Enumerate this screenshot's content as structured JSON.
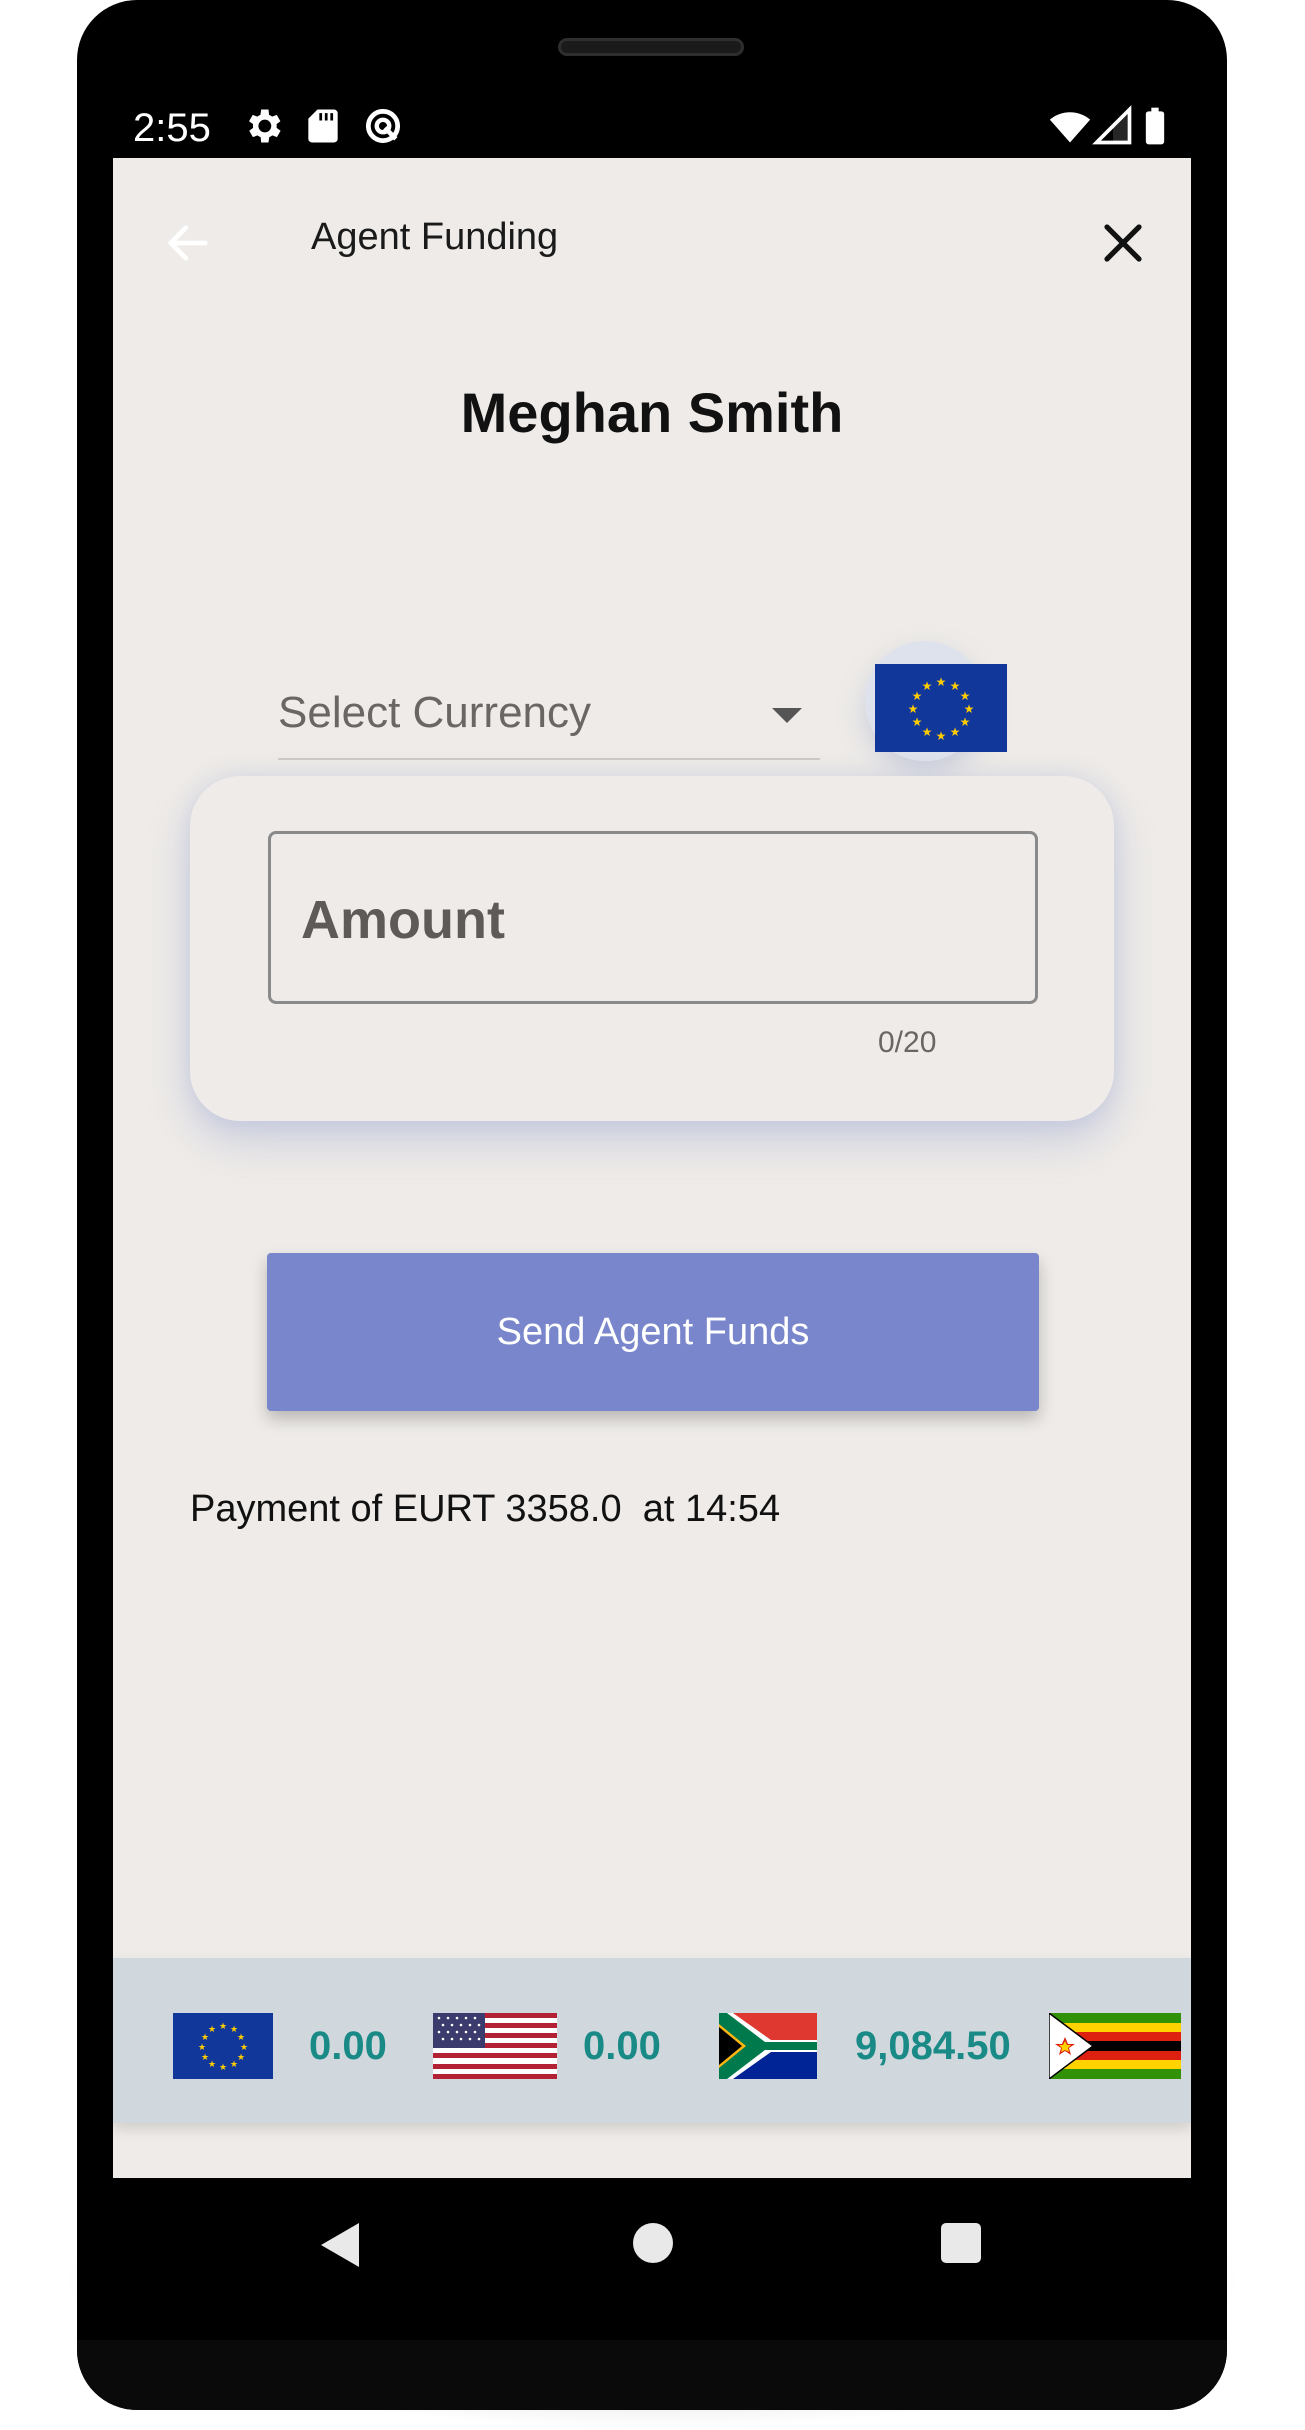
{
  "status_bar": {
    "time": "2:55",
    "icons": [
      "gear-icon",
      "sd-card-icon",
      "sync-icon",
      "wifi-icon",
      "signal-icon",
      "battery-icon"
    ]
  },
  "header": {
    "title": "Agent Funding",
    "back_icon": "arrow-left-icon",
    "close_icon": "close-icon"
  },
  "user": {
    "name": "Meghan Smith"
  },
  "currency": {
    "label": "Select Currency",
    "selected_flag": "eu-flag-icon"
  },
  "amount": {
    "placeholder": "Amount",
    "counter": "0/20"
  },
  "send_button": {
    "label": "Send Agent Funds"
  },
  "payment_status": "Payment of EURT 3358.0  at 14:54",
  "balances": [
    {
      "flag": "eu-flag-icon",
      "value": "0.00"
    },
    {
      "flag": "us-flag-icon",
      "value": "0.00"
    },
    {
      "flag": "za-flag-icon",
      "value": "9,084.50"
    },
    {
      "flag": "zw-flag-icon",
      "value": ""
    }
  ],
  "colors": {
    "accent": "#7986cb",
    "balance_text": "#1a8a86",
    "screen_bg": "#eeebe8",
    "balance_bar": "#d0d8de"
  },
  "nav": {
    "back": "nav-back-icon",
    "home": "nav-home-icon",
    "recents": "nav-recents-icon"
  }
}
